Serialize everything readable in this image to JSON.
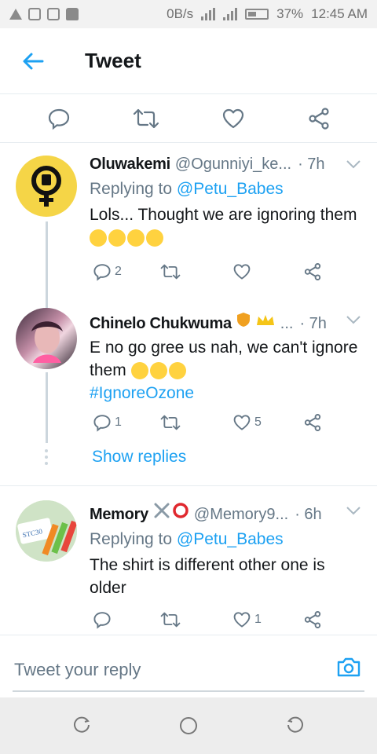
{
  "status_bar": {
    "left_icons": [
      "warning-icon",
      "image-icon",
      "sim-icon",
      "lock-icon"
    ],
    "speed": "0B/s",
    "battery": "37%",
    "time": "12:45 AM"
  },
  "header": {
    "title": "Tweet"
  },
  "replies": [
    {
      "name": "Oluwakemi",
      "handle": "@Ogunniyi_ke...",
      "time": "· 7h",
      "replying_prefix": "Replying to",
      "replying_to": "@Petu_Babes",
      "text": "Lols... Thought we are ignoring them",
      "replies_count": "2",
      "likes_count": ""
    },
    {
      "name": "Chinelo Chukwuma",
      "handle": "...",
      "time": "· 7h",
      "text": "E no go gree us nah, we can't ignore them",
      "hashtag": "#IgnoreOzone",
      "replies_count": "1",
      "likes_count": "5"
    },
    {
      "name": "Memory",
      "handle": "@Memory9...",
      "time": "· 6h",
      "replying_prefix": "Replying to",
      "replying_to": "@Petu_Babes",
      "text": "The shirt is different other one is older",
      "replies_count": "",
      "likes_count": "1"
    }
  ],
  "show_replies": "Show replies",
  "compose": {
    "placeholder": "Tweet your reply"
  },
  "colors": {
    "accent": "#1da1f2",
    "muted": "#657786",
    "text": "#14171a"
  }
}
